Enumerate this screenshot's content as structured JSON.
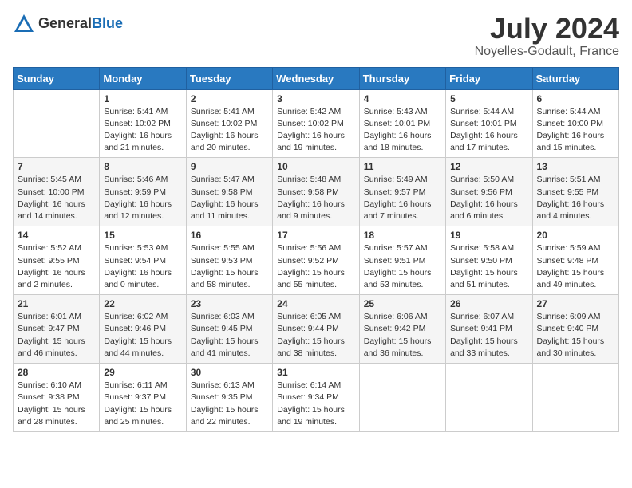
{
  "header": {
    "logo_general": "General",
    "logo_blue": "Blue",
    "title": "July 2024",
    "location": "Noyelles-Godault, France"
  },
  "weekdays": [
    "Sunday",
    "Monday",
    "Tuesday",
    "Wednesday",
    "Thursday",
    "Friday",
    "Saturday"
  ],
  "weeks": [
    [
      {
        "day": "",
        "info": ""
      },
      {
        "day": "1",
        "info": "Sunrise: 5:41 AM\nSunset: 10:02 PM\nDaylight: 16 hours\nand 21 minutes."
      },
      {
        "day": "2",
        "info": "Sunrise: 5:41 AM\nSunset: 10:02 PM\nDaylight: 16 hours\nand 20 minutes."
      },
      {
        "day": "3",
        "info": "Sunrise: 5:42 AM\nSunset: 10:02 PM\nDaylight: 16 hours\nand 19 minutes."
      },
      {
        "day": "4",
        "info": "Sunrise: 5:43 AM\nSunset: 10:01 PM\nDaylight: 16 hours\nand 18 minutes."
      },
      {
        "day": "5",
        "info": "Sunrise: 5:44 AM\nSunset: 10:01 PM\nDaylight: 16 hours\nand 17 minutes."
      },
      {
        "day": "6",
        "info": "Sunrise: 5:44 AM\nSunset: 10:00 PM\nDaylight: 16 hours\nand 15 minutes."
      }
    ],
    [
      {
        "day": "7",
        "info": "Sunrise: 5:45 AM\nSunset: 10:00 PM\nDaylight: 16 hours\nand 14 minutes."
      },
      {
        "day": "8",
        "info": "Sunrise: 5:46 AM\nSunset: 9:59 PM\nDaylight: 16 hours\nand 12 minutes."
      },
      {
        "day": "9",
        "info": "Sunrise: 5:47 AM\nSunset: 9:58 PM\nDaylight: 16 hours\nand 11 minutes."
      },
      {
        "day": "10",
        "info": "Sunrise: 5:48 AM\nSunset: 9:58 PM\nDaylight: 16 hours\nand 9 minutes."
      },
      {
        "day": "11",
        "info": "Sunrise: 5:49 AM\nSunset: 9:57 PM\nDaylight: 16 hours\nand 7 minutes."
      },
      {
        "day": "12",
        "info": "Sunrise: 5:50 AM\nSunset: 9:56 PM\nDaylight: 16 hours\nand 6 minutes."
      },
      {
        "day": "13",
        "info": "Sunrise: 5:51 AM\nSunset: 9:55 PM\nDaylight: 16 hours\nand 4 minutes."
      }
    ],
    [
      {
        "day": "14",
        "info": "Sunrise: 5:52 AM\nSunset: 9:55 PM\nDaylight: 16 hours\nand 2 minutes."
      },
      {
        "day": "15",
        "info": "Sunrise: 5:53 AM\nSunset: 9:54 PM\nDaylight: 16 hours\nand 0 minutes."
      },
      {
        "day": "16",
        "info": "Sunrise: 5:55 AM\nSunset: 9:53 PM\nDaylight: 15 hours\nand 58 minutes."
      },
      {
        "day": "17",
        "info": "Sunrise: 5:56 AM\nSunset: 9:52 PM\nDaylight: 15 hours\nand 55 minutes."
      },
      {
        "day": "18",
        "info": "Sunrise: 5:57 AM\nSunset: 9:51 PM\nDaylight: 15 hours\nand 53 minutes."
      },
      {
        "day": "19",
        "info": "Sunrise: 5:58 AM\nSunset: 9:50 PM\nDaylight: 15 hours\nand 51 minutes."
      },
      {
        "day": "20",
        "info": "Sunrise: 5:59 AM\nSunset: 9:48 PM\nDaylight: 15 hours\nand 49 minutes."
      }
    ],
    [
      {
        "day": "21",
        "info": "Sunrise: 6:01 AM\nSunset: 9:47 PM\nDaylight: 15 hours\nand 46 minutes."
      },
      {
        "day": "22",
        "info": "Sunrise: 6:02 AM\nSunset: 9:46 PM\nDaylight: 15 hours\nand 44 minutes."
      },
      {
        "day": "23",
        "info": "Sunrise: 6:03 AM\nSunset: 9:45 PM\nDaylight: 15 hours\nand 41 minutes."
      },
      {
        "day": "24",
        "info": "Sunrise: 6:05 AM\nSunset: 9:44 PM\nDaylight: 15 hours\nand 38 minutes."
      },
      {
        "day": "25",
        "info": "Sunrise: 6:06 AM\nSunset: 9:42 PM\nDaylight: 15 hours\nand 36 minutes."
      },
      {
        "day": "26",
        "info": "Sunrise: 6:07 AM\nSunset: 9:41 PM\nDaylight: 15 hours\nand 33 minutes."
      },
      {
        "day": "27",
        "info": "Sunrise: 6:09 AM\nSunset: 9:40 PM\nDaylight: 15 hours\nand 30 minutes."
      }
    ],
    [
      {
        "day": "28",
        "info": "Sunrise: 6:10 AM\nSunset: 9:38 PM\nDaylight: 15 hours\nand 28 minutes."
      },
      {
        "day": "29",
        "info": "Sunrise: 6:11 AM\nSunset: 9:37 PM\nDaylight: 15 hours\nand 25 minutes."
      },
      {
        "day": "30",
        "info": "Sunrise: 6:13 AM\nSunset: 9:35 PM\nDaylight: 15 hours\nand 22 minutes."
      },
      {
        "day": "31",
        "info": "Sunrise: 6:14 AM\nSunset: 9:34 PM\nDaylight: 15 hours\nand 19 minutes."
      },
      {
        "day": "",
        "info": ""
      },
      {
        "day": "",
        "info": ""
      },
      {
        "day": "",
        "info": ""
      }
    ]
  ]
}
